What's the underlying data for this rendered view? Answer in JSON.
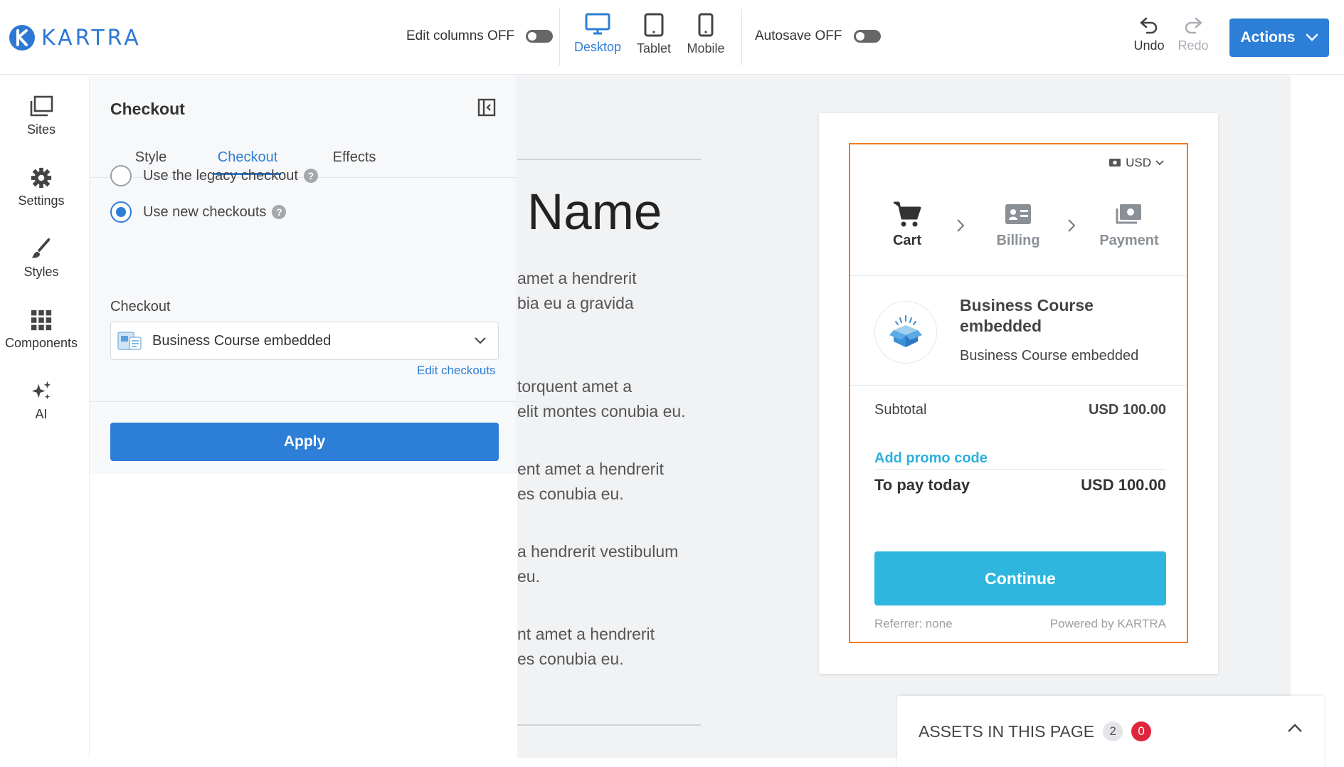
{
  "brand": {
    "name": "KARTRA",
    "color": "#2c78d4"
  },
  "topbar": {
    "edit_columns": "Edit columns OFF",
    "devices": [
      {
        "label": "Desktop",
        "icon": "desktop-icon",
        "active": true
      },
      {
        "label": "Tablet",
        "icon": "tablet-icon",
        "active": false
      },
      {
        "label": "Mobile",
        "icon": "mobile-icon",
        "active": false
      }
    ],
    "autosave": "Autosave OFF",
    "undo": "Undo",
    "redo": "Redo",
    "actions": "Actions"
  },
  "rail": {
    "items": [
      {
        "label": "Sites",
        "icon": "sites-icon"
      },
      {
        "label": "Settings",
        "icon": "gear-icon"
      },
      {
        "label": "Styles",
        "icon": "brush-icon"
      },
      {
        "label": "Components",
        "icon": "grid-icon"
      },
      {
        "label": "AI",
        "icon": "sparkle-icon"
      }
    ]
  },
  "panel": {
    "title": "Checkout",
    "tabs": [
      {
        "label": "Style",
        "active": false
      },
      {
        "label": "Checkout",
        "active": true
      },
      {
        "label": "Effects",
        "active": false
      }
    ],
    "options": [
      {
        "label": "Use the legacy checkout",
        "selected": false
      },
      {
        "label": "Use new checkouts",
        "selected": true
      }
    ],
    "checkout_label": "Checkout",
    "checkout_value": "Business Course embedded",
    "edit_link": "Edit checkouts",
    "apply": "Apply"
  },
  "canvas": {
    "title": "Name",
    "lines": [
      "amet a hendrerit",
      "bia eu a gravida",
      "torquent amet a",
      "elit montes conubia eu.",
      "ent amet a hendrerit",
      "es conubia eu.",
      "a hendrerit vestibulum",
      "eu.",
      "nt amet a hendrerit",
      "es conubia eu."
    ]
  },
  "checkout_widget": {
    "currency": "USD",
    "steps": [
      {
        "label": "Cart",
        "icon": "cart-icon",
        "active": true
      },
      {
        "label": "Billing",
        "icon": "id-card-icon",
        "active": false
      },
      {
        "label": "Payment",
        "icon": "payment-icon",
        "active": false
      }
    ],
    "product_name": "Business Course embedded",
    "product_sub": "Business Course embedded",
    "subtotal_label": "Subtotal",
    "subtotal_value": "USD 100.00",
    "promo": "Add promo code",
    "total_label": "To pay today",
    "total_value": "USD 100.00",
    "continue": "Continue",
    "referrer": "Referrer: none",
    "powered": "Powered by KARTRA",
    "accent": "#2fb6df",
    "frame_color": "#f07a24"
  },
  "assets": {
    "label": "ASSETS IN THIS PAGE",
    "count": "2",
    "alerts": "0"
  }
}
